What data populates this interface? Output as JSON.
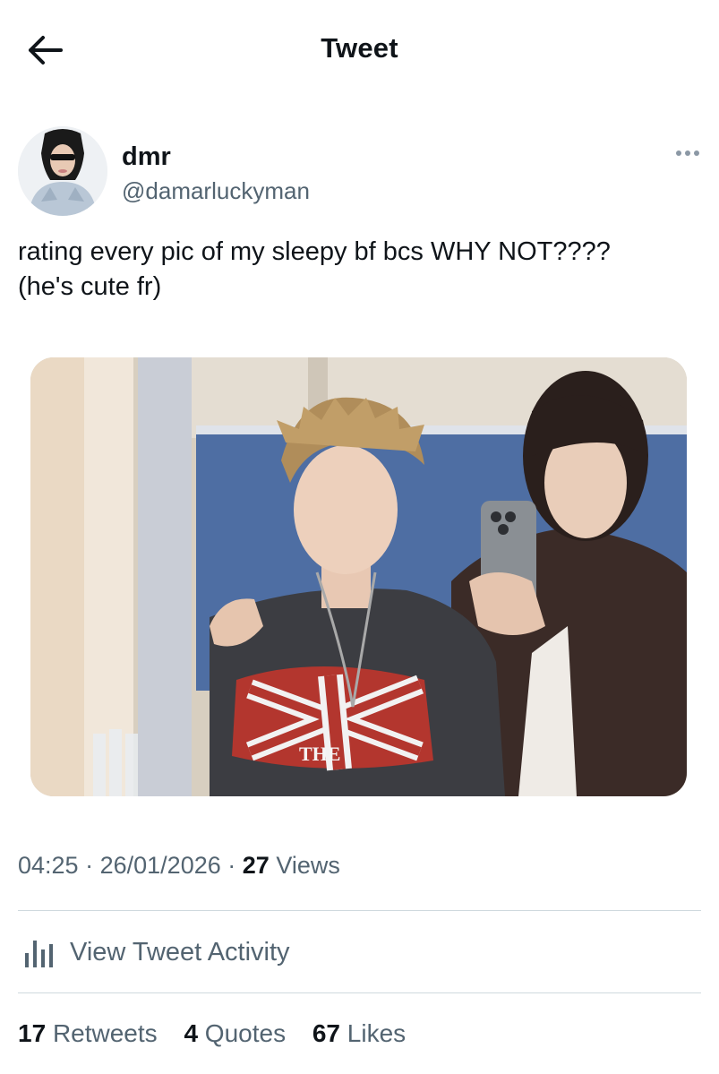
{
  "header": {
    "title": "Tweet",
    "back_icon": "arrow-left-icon"
  },
  "author": {
    "display_name": "dmr",
    "handle": "@damarluckyman",
    "avatar_icon": "avatar-photo",
    "more_icon": "more-horizontal-icon"
  },
  "tweet": {
    "line1": "rating every pic of my sleepy bf bcs WHY NOT????",
    "line2": "(he's cute fr)",
    "image_shirt_text": "THE"
  },
  "meta": {
    "time": "04:25",
    "separator": "·",
    "date": "26/01/2026",
    "views_count": "27",
    "views_label": "Views"
  },
  "activity": {
    "label": "View Tweet Activity",
    "icon": "bar-chart-icon"
  },
  "stats": {
    "retweets_count": "17",
    "retweets_label": "Retweets",
    "quotes_count": "4",
    "quotes_label": "Quotes",
    "likes_count": "67",
    "likes_label": "Likes"
  },
  "colors": {
    "text": "#0f1419",
    "secondary": "#536471",
    "divider": "#cfd9de"
  }
}
